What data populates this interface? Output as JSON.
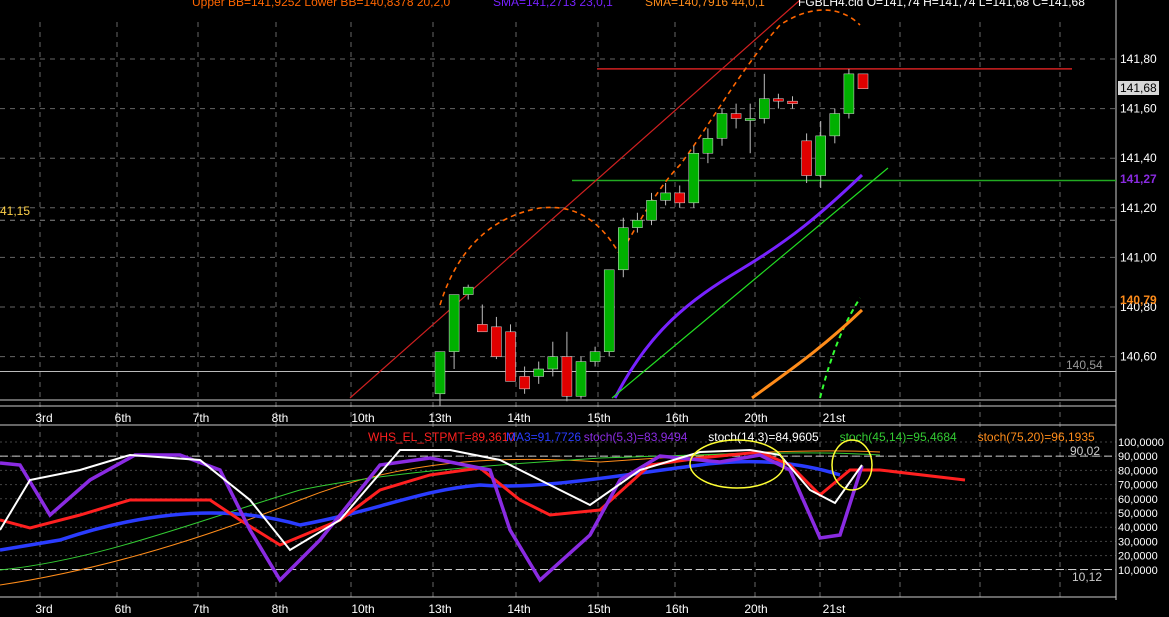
{
  "header": {
    "bb": "Upper BB=141,9252 Lower BB=140,8378 20,2,0",
    "sma1": "SMA=141,2713 23,0,1",
    "sma2": "SMA=140,7916 44,0,1",
    "ohlc": "FGBLH4.cld O=141,74 H=141,74 L=141,68 C=141,68"
  },
  "colors": {
    "bb": "#ff6600",
    "bb_lower": "#33ff33",
    "sma1": "#7722ff",
    "sma2": "#ff8c1a",
    "bull": "#00b000",
    "bear": "#e00000",
    "grid": "#666666",
    "axis_text": "#ffffff"
  },
  "price_panel": {
    "left_label": "41,15",
    "level_label": "140,54",
    "price_boxes": [
      "141,68",
      "141,27",
      "140,79"
    ],
    "y_ticks": [
      "141,80",
      "141,60",
      "141,40",
      "141,20",
      "141,00",
      "140,80",
      "140,60"
    ]
  },
  "indicator_panel": {
    "legend": [
      {
        "text": "WHS_EL_STPMT=89,3610",
        "color": "#ff2020"
      },
      {
        "text": "MA3=91,7726",
        "color": "#2a3cff"
      },
      {
        "text": "stoch(5,3)=83,9494",
        "color": "#8a2be2"
      },
      {
        "text": "stoch(14,3)=84,9605",
        "color": "#ffffff"
      },
      {
        "text": "stoch(45,14)=95,4684",
        "color": "#33cc33"
      },
      {
        "text": "stoch(75,20)=96,1935",
        "color": "#ff8c1a"
      }
    ],
    "level_upper": "90,02",
    "level_lower": "10,12",
    "y_ticks": [
      "100,0000",
      "90,0000",
      "80,0000",
      "70,0000",
      "60,0000",
      "50,0000",
      "40,0000",
      "30,0000",
      "20,0000",
      "10,0000"
    ]
  },
  "x_labels": [
    "3rd",
    "6th",
    "7th",
    "8th",
    "10th",
    "13th",
    "14th",
    "15th",
    "16th",
    "20th",
    "21st"
  ],
  "chart_data": {
    "type": "candlestick",
    "symbol": "FGBLH4",
    "ylim": [
      140.43,
      141.95
    ],
    "price_lines": [
      141.76,
      141.31,
      141.15,
      140.54
    ],
    "candles": [
      {
        "o": 140.45,
        "h": 140.62,
        "l": 140.4,
        "c": 140.62
      },
      {
        "o": 140.62,
        "h": 140.85,
        "l": 140.55,
        "c": 140.85
      },
      {
        "o": 140.85,
        "h": 140.89,
        "l": 140.83,
        "c": 140.88
      },
      {
        "o": 140.73,
        "h": 140.81,
        "l": 140.71,
        "c": 140.7
      },
      {
        "o": 140.72,
        "h": 140.76,
        "l": 140.59,
        "c": 140.6
      },
      {
        "o": 140.7,
        "h": 140.73,
        "l": 140.5,
        "c": 140.5
      },
      {
        "o": 140.52,
        "h": 140.56,
        "l": 140.45,
        "c": 140.47
      },
      {
        "o": 140.52,
        "h": 140.58,
        "l": 140.49,
        "c": 140.55
      },
      {
        "o": 140.55,
        "h": 140.66,
        "l": 140.52,
        "c": 140.6
      },
      {
        "o": 140.6,
        "h": 140.7,
        "l": 140.42,
        "c": 140.44
      },
      {
        "o": 140.44,
        "h": 140.6,
        "l": 140.43,
        "c": 140.58
      },
      {
        "o": 140.58,
        "h": 140.64,
        "l": 140.56,
        "c": 140.62
      },
      {
        "o": 140.62,
        "h": 140.8,
        "l": 140.6,
        "c": 140.95
      },
      {
        "o": 140.95,
        "h": 141.16,
        "l": 140.92,
        "c": 141.12
      },
      {
        "o": 141.12,
        "h": 141.18,
        "l": 141.1,
        "c": 141.15
      },
      {
        "o": 141.15,
        "h": 141.26,
        "l": 141.13,
        "c": 141.23
      },
      {
        "o": 141.23,
        "h": 141.3,
        "l": 141.21,
        "c": 141.26
      },
      {
        "o": 141.26,
        "h": 141.29,
        "l": 141.2,
        "c": 141.22
      },
      {
        "o": 141.22,
        "h": 141.45,
        "l": 141.2,
        "c": 141.42
      },
      {
        "o": 141.42,
        "h": 141.52,
        "l": 141.38,
        "c": 141.48
      },
      {
        "o": 141.48,
        "h": 141.6,
        "l": 141.45,
        "c": 141.58
      },
      {
        "o": 141.58,
        "h": 141.62,
        "l": 141.52,
        "c": 141.56
      },
      {
        "o": 141.56,
        "h": 141.62,
        "l": 141.42,
        "c": 141.56
      },
      {
        "o": 141.56,
        "h": 141.74,
        "l": 141.54,
        "c": 141.64
      },
      {
        "o": 141.64,
        "h": 141.66,
        "l": 141.6,
        "c": 141.63
      },
      {
        "o": 141.63,
        "h": 141.65,
        "l": 141.6,
        "c": 141.62
      },
      {
        "o": 141.47,
        "h": 141.5,
        "l": 141.3,
        "c": 141.33
      },
      {
        "o": 141.33,
        "h": 141.55,
        "l": 141.28,
        "c": 141.49
      },
      {
        "o": 141.49,
        "h": 141.6,
        "l": 141.46,
        "c": 141.58
      },
      {
        "o": 141.58,
        "h": 141.76,
        "l": 141.56,
        "c": 141.74
      },
      {
        "o": 141.74,
        "h": 141.74,
        "l": 141.68,
        "c": 141.68
      }
    ],
    "osc_ylim": [
      5,
      105
    ],
    "osc_levels": [
      90.02,
      10.12
    ]
  }
}
